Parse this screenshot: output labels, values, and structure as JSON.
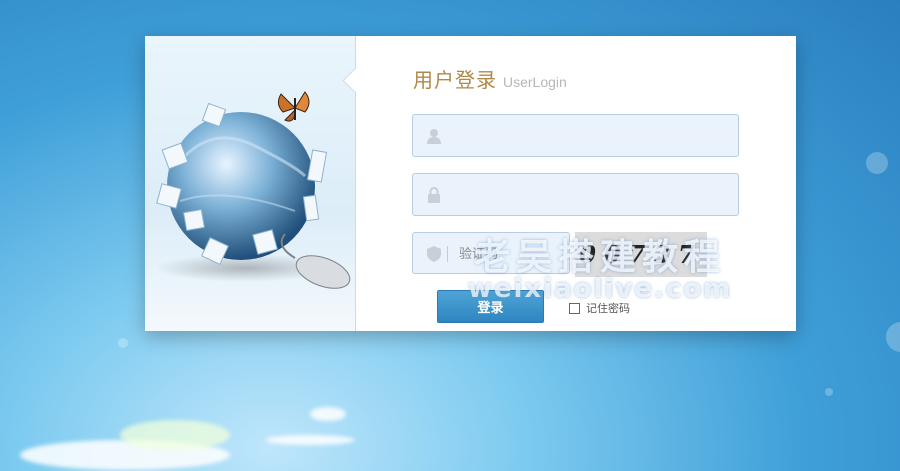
{
  "login": {
    "title": "用户登录",
    "subtitle": "UserLogin",
    "username": {
      "value": "",
      "placeholder": ""
    },
    "password": {
      "value": "",
      "placeholder": ""
    },
    "captcha": {
      "value": "",
      "placeholder": "验证码",
      "image_text": "00737"
    },
    "submit_label": "登录",
    "remember_label": "记住密码",
    "remember_checked": false
  },
  "watermark": {
    "line1": "老吴搭建教程",
    "line2": "weixiaolive.com"
  },
  "colors": {
    "title": "#b08848",
    "button": "#2e86c1",
    "field_bg": "#eaf3fb",
    "background": "#3f9fd8"
  },
  "icons": [
    "user-icon",
    "lock-icon",
    "shield-icon",
    "globe-puzzle-illustration",
    "butterfly-icon",
    "mouse-illustration"
  ]
}
